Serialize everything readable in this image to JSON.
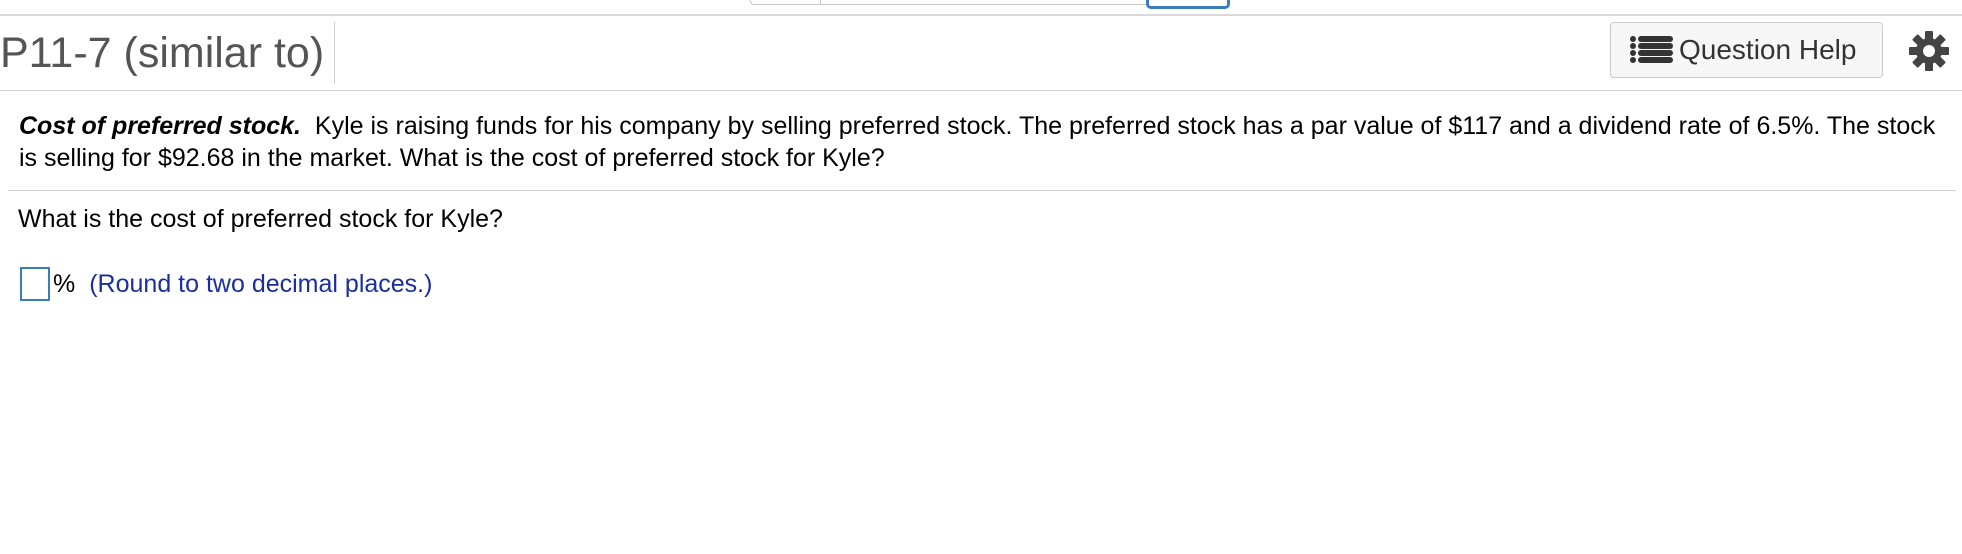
{
  "header": {
    "title": "P11-7 (similar to)",
    "help_label": "Question Help"
  },
  "problem": {
    "lead": "Cost of preferred stock.",
    "text": "Kyle is raising funds for his company by selling preferred stock.  The preferred stock has a par value of $117 and a dividend rate of 6.5%.  The stock is selling for $92.68 in the market.  What is the cost of preferred stock for Kyle?"
  },
  "question": {
    "text": "What is the cost of preferred stock for Kyle?",
    "answer_value": "",
    "unit": "%",
    "hint": "(Round to two decimal places.)"
  },
  "colors": {
    "accent": "#3b7bbf",
    "hint_text": "#1a2ea0",
    "title_text": "#555555"
  },
  "icons": [
    "list-icon",
    "gear-icon"
  ]
}
